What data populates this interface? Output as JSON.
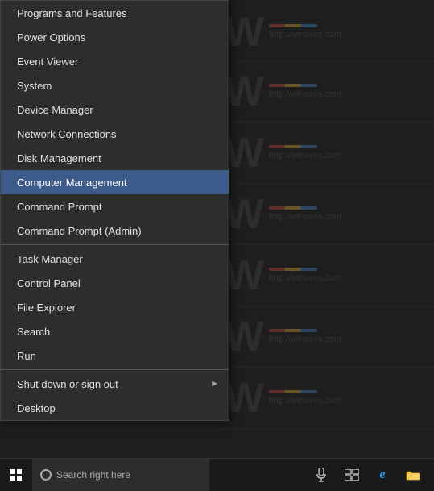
{
  "desktop": {
    "background_color": "#1e1e1e"
  },
  "watermark": {
    "text": "http://winaero.com",
    "bars": [
      {
        "colors": [
          "#e05050",
          "#f0c040",
          "#5090e0"
        ]
      },
      {
        "colors": [
          "#e05050",
          "#f0c040",
          "#5090e0"
        ]
      },
      {
        "colors": [
          "#e05050",
          "#f0c040",
          "#5090e0"
        ]
      },
      {
        "colors": [
          "#e05050",
          "#f0c040",
          "#5090e0"
        ]
      },
      {
        "colors": [
          "#e05050",
          "#f0c040",
          "#5090e0"
        ]
      },
      {
        "colors": [
          "#e05050",
          "#f0c040",
          "#5090e0"
        ]
      },
      {
        "colors": [
          "#e05050",
          "#f0c040",
          "#5090e0"
        ]
      },
      {
        "colors": [
          "#e05050",
          "#f0c040",
          "#5090e0"
        ]
      }
    ]
  },
  "context_menu": {
    "items": [
      {
        "id": "programs-features",
        "label": "Programs and Features",
        "separator_above": false,
        "has_arrow": false
      },
      {
        "id": "power-options",
        "label": "Power Options",
        "separator_above": false,
        "has_arrow": false
      },
      {
        "id": "event-viewer",
        "label": "Event Viewer",
        "separator_above": false,
        "has_arrow": false
      },
      {
        "id": "system",
        "label": "System",
        "separator_above": false,
        "has_arrow": false
      },
      {
        "id": "device-manager",
        "label": "Device Manager",
        "separator_above": false,
        "has_arrow": false
      },
      {
        "id": "network-connections",
        "label": "Network Connections",
        "separator_above": false,
        "has_arrow": false
      },
      {
        "id": "disk-management",
        "label": "Disk Management",
        "separator_above": false,
        "has_arrow": false
      },
      {
        "id": "computer-management",
        "label": "Computer Management",
        "separator_above": false,
        "has_arrow": false,
        "highlighted": true
      },
      {
        "id": "command-prompt",
        "label": "Command Prompt",
        "separator_above": false,
        "has_arrow": false
      },
      {
        "id": "command-prompt-admin",
        "label": "Command Prompt (Admin)",
        "separator_above": false,
        "has_arrow": false
      },
      {
        "id": "task-manager",
        "label": "Task Manager",
        "separator_above": true,
        "has_arrow": false
      },
      {
        "id": "control-panel",
        "label": "Control Panel",
        "separator_above": false,
        "has_arrow": false
      },
      {
        "id": "file-explorer",
        "label": "File Explorer",
        "separator_above": false,
        "has_arrow": false
      },
      {
        "id": "search",
        "label": "Search",
        "separator_above": false,
        "has_arrow": false
      },
      {
        "id": "run",
        "label": "Run",
        "separator_above": false,
        "has_arrow": false
      },
      {
        "id": "shut-down",
        "label": "Shut down or sign out",
        "separator_above": true,
        "has_arrow": true
      },
      {
        "id": "desktop",
        "label": "Desktop",
        "separator_above": false,
        "has_arrow": false
      }
    ]
  },
  "taskbar": {
    "search_placeholder": "Search right here",
    "start_tooltip": "Start"
  }
}
